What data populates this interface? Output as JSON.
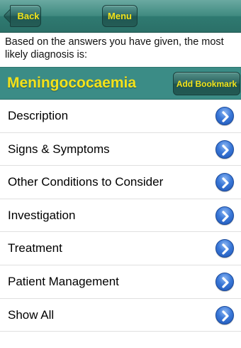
{
  "navbar": {
    "back_label": "Back",
    "menu_label": "Menu"
  },
  "intro_text": "Based on the answers you have given, the most likely diagnosis is:",
  "diagnosis": {
    "title": "Meningococaemia",
    "bookmark_label": "Add Bookmark"
  },
  "items": [
    {
      "label": "Description",
      "icon": "chevron-right-icon"
    },
    {
      "label": "Signs & Symptoms",
      "icon": "chevron-right-icon"
    },
    {
      "label": "Other Conditions to Consider",
      "icon": "chevron-right-icon"
    },
    {
      "label": "Investigation",
      "icon": "chevron-right-icon"
    },
    {
      "label": "Treatment",
      "icon": "chevron-right-icon"
    },
    {
      "label": "Patient Management",
      "icon": "chevron-right-icon"
    },
    {
      "label": "Show All",
      "icon": "chevron-right-icon"
    }
  ],
  "colors": {
    "header_teal": "#3b8c86",
    "button_text_yellow": "#f2e21a",
    "disclosure_blue": "#3a78d8"
  }
}
